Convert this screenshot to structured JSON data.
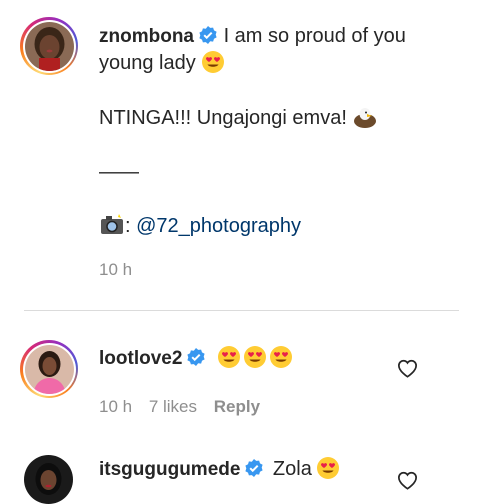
{
  "comments": [
    {
      "username": "znombona",
      "verified": true,
      "lines": [
        "I am so proud of you",
        "young lady",
        "NTINGA!!! Ungajongi emva!",
        "——",
        ":",
        "@72_photography"
      ],
      "time": "10 h"
    },
    {
      "username": "lootlove2",
      "verified": true,
      "time": "10 h",
      "likes": "7 likes",
      "reply_label": "Reply"
    },
    {
      "username": "itsgugugumede",
      "verified": true,
      "text": "Zola"
    }
  ],
  "colors": {
    "text": "#262626",
    "meta": "#8e8e8e",
    "mention": "#00376b",
    "verified": "#3897f0",
    "divider": "#dbdbdb"
  },
  "icons": {
    "verified": "verified-badge-icon",
    "heart_eyes": "heart-eyes-emoji",
    "eagle": "eagle-emoji",
    "camera": "camera-flash-emoji",
    "like": "heart-outline-icon"
  }
}
